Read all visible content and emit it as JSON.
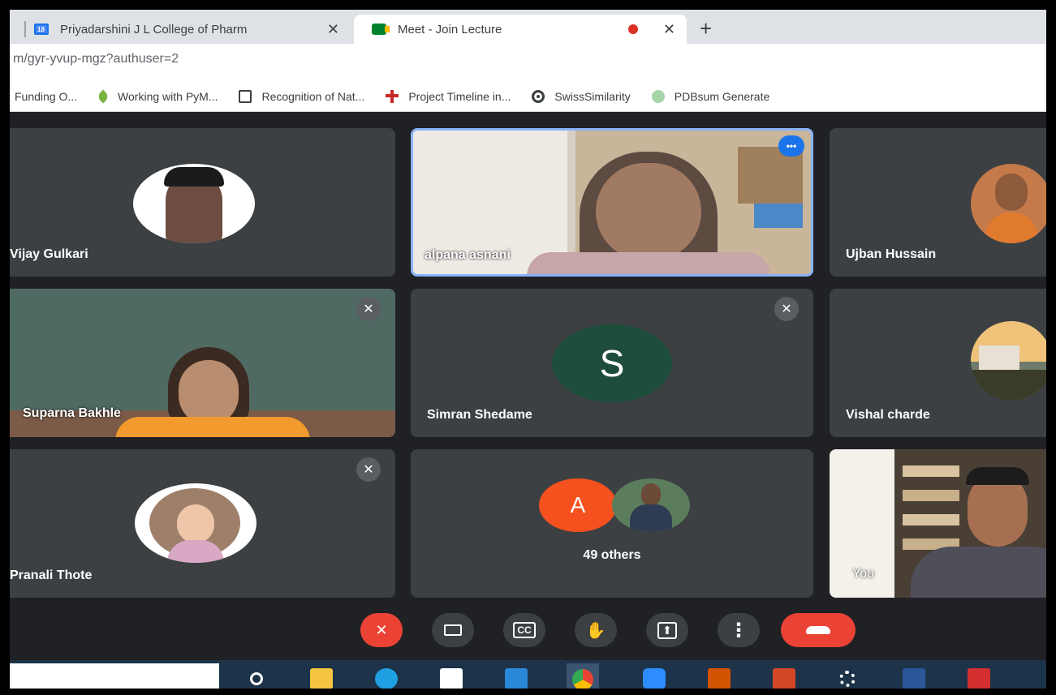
{
  "browser": {
    "tabs": [
      {
        "title": "Priyadarshini J L College of Pharm",
        "favicon": "calendar-icon"
      },
      {
        "title": "Meet - Join Lecture",
        "favicon": "meet-icon",
        "recording": true
      }
    ],
    "close_glyph": "✕",
    "new_tab_glyph": "+",
    "url": "m/gyr-yvup-mgz?authuser=2",
    "bookmarks": [
      {
        "label": "Funding O...",
        "icon": "none"
      },
      {
        "label": "Working with PyM...",
        "icon": "leaf-icon"
      },
      {
        "label": "Recognition of Nat...",
        "icon": "page-icon"
      },
      {
        "label": "Project Timeline in...",
        "icon": "cross-icon"
      },
      {
        "label": "SwissSimilarity",
        "icon": "globe-icon"
      },
      {
        "label": "PDBsum Generate",
        "icon": "pdb-icon"
      }
    ]
  },
  "meet": {
    "participants": [
      {
        "name": "Vijay Gulkari",
        "type": "photo",
        "muted": false
      },
      {
        "name": "alpana asnani",
        "type": "video",
        "muted": false,
        "active_speaker": true,
        "more_glyph": "•••"
      },
      {
        "name": "Ujban Hussain",
        "type": "photo",
        "muted": false
      },
      {
        "name": "Suparna Bakhle",
        "type": "video",
        "muted": true
      },
      {
        "name": "Simran Shedame",
        "type": "initial",
        "initial": "S",
        "muted": true
      },
      {
        "name": "Vishal charde",
        "type": "photo",
        "muted": false
      },
      {
        "name": "Pranali Thote",
        "type": "photo",
        "muted": true
      },
      {
        "name": "49 others",
        "type": "group",
        "initial": "A",
        "muted": false
      },
      {
        "name": "You",
        "type": "video",
        "muted": false
      }
    ],
    "controls": [
      {
        "name": "mic-off",
        "glyph": "🎙"
      },
      {
        "name": "camera",
        "glyph": "▭"
      },
      {
        "name": "captions",
        "glyph": "CC"
      },
      {
        "name": "raise-hand",
        "glyph": "✋"
      },
      {
        "name": "present",
        "glyph": "⬆"
      },
      {
        "name": "more-options",
        "glyph": "⋮"
      },
      {
        "name": "leave-call",
        "glyph": "☎"
      }
    ]
  },
  "taskbar": {
    "items": [
      "cortana-icon",
      "file-explorer-icon",
      "edge-icon",
      "store-icon",
      "mail-icon",
      "chrome-icon",
      "zoom-icon",
      "app-icon",
      "powerpoint-icon",
      "settings-icon",
      "word-icon",
      "acrobat-icon"
    ]
  },
  "colors": {
    "meet_bg": "#202124",
    "tile_bg": "#3c4043",
    "leave_red": "#ea4335",
    "simran_avatar": "#1e4d3c",
    "others_avatar": "#f4511e",
    "active_border": "#8ab4f8"
  }
}
